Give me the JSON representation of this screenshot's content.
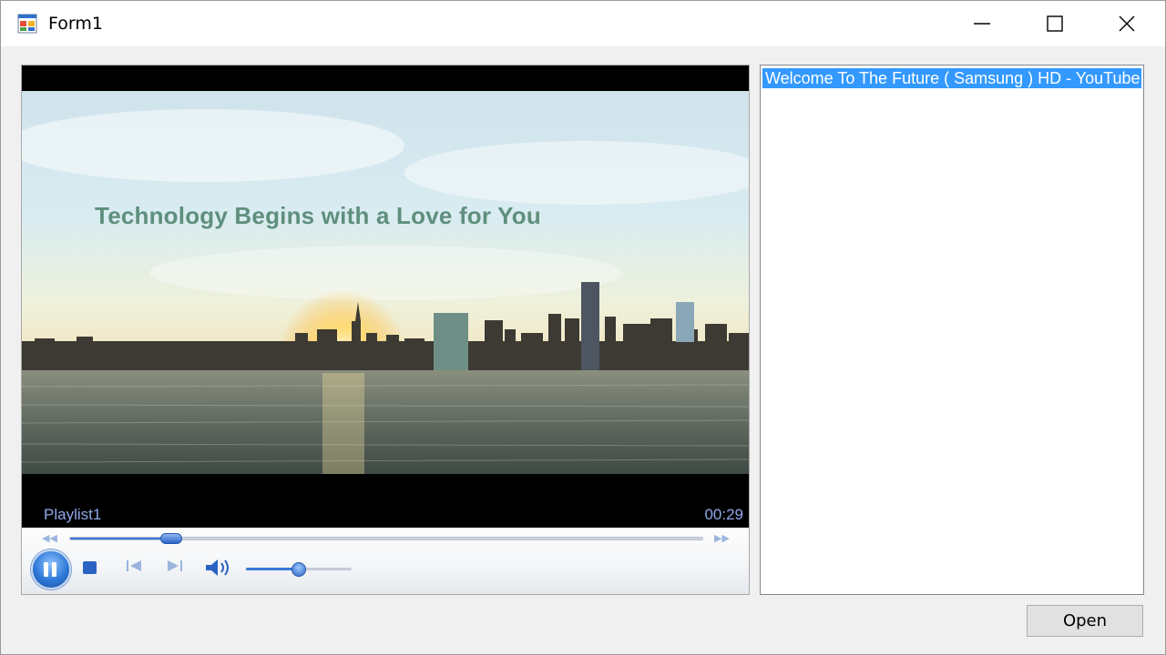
{
  "window": {
    "title": "Form1",
    "icons": {
      "app": "form-app-icon",
      "minimize": "minimize-icon",
      "maximize": "maximize-icon",
      "close": "close-icon"
    }
  },
  "player": {
    "video_caption": "Technology Begins with a Love for You",
    "playlist_name": "Playlist1",
    "time": "00:29",
    "seek_position": 0.16,
    "volume": 0.5,
    "state": "playing",
    "accent_color": "#3a78d6"
  },
  "playlist": {
    "items": [
      "Welcome To The Future ( Samsung ) HD - YouTube"
    ],
    "selected_index": 0,
    "selection_color": "#3399ff"
  },
  "buttons": {
    "open_label": "Open"
  }
}
